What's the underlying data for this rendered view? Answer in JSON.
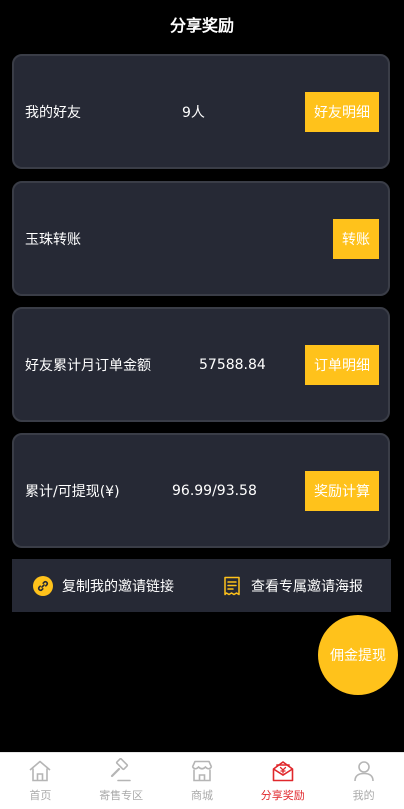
{
  "header": {
    "title": "分享奖励"
  },
  "cards": [
    {
      "label": "我的好友",
      "value": "9人",
      "button": "好友明细"
    },
    {
      "label": "玉珠转账",
      "value": "",
      "button": "转账"
    },
    {
      "label": "好友累计月订单金额",
      "value": "57588.84",
      "button": "订单明细"
    },
    {
      "label": "累计/可提现(¥)",
      "value": "96.99/93.58",
      "button": "奖励计算"
    }
  ],
  "invite": {
    "copy_link": "复制我的邀请链接",
    "view_poster": "查看专属邀请海报"
  },
  "fab": {
    "label": "佣金提现"
  },
  "tabbar": {
    "items": [
      {
        "label": "首页",
        "icon": "home-icon"
      },
      {
        "label": "寄售专区",
        "icon": "hammer-icon"
      },
      {
        "label": "商城",
        "icon": "shop-icon"
      },
      {
        "label": "分享奖励",
        "icon": "share-reward-icon",
        "active": true
      },
      {
        "label": "我的",
        "icon": "user-icon"
      }
    ]
  },
  "colors": {
    "accent": "#ffc21b",
    "active_tab": "#e0282c",
    "card_bg": "#262935"
  }
}
